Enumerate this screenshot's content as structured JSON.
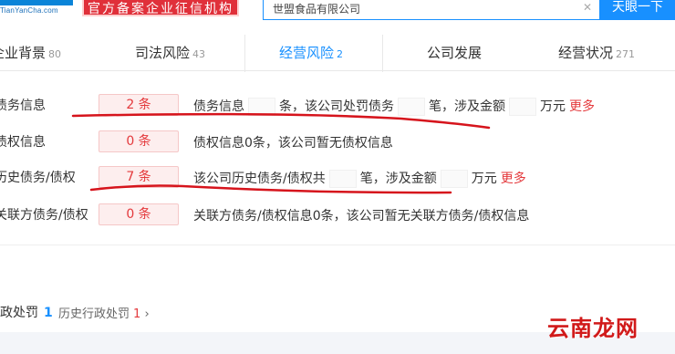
{
  "header": {
    "logo_sub": "TianYanCha.com",
    "cert_badge": "官方备案企业征信机构",
    "search_value": "世盟食品有限公司",
    "search_button": "天眼一下"
  },
  "tabs": [
    {
      "label": "企业背景",
      "count": "80",
      "active": false
    },
    {
      "label": "司法风险",
      "count": "43",
      "active": false
    },
    {
      "label": "经营风险",
      "count": "2",
      "active": true
    },
    {
      "label": "公司发展",
      "count": "",
      "active": false
    },
    {
      "label": "经营状况",
      "count": "271",
      "active": false
    }
  ],
  "rows": [
    {
      "label": "债务信息",
      "count": "2 条",
      "desc_a": "债务信息",
      "desc_b": "条，该公司处罚债务",
      "desc_c": "笔，涉及金额",
      "desc_d": "万元",
      "more": "更多"
    },
    {
      "label": "债权信息",
      "count": "0 条",
      "desc": "债权信息0条，该公司暂无债权信息"
    },
    {
      "label": "历史债务/债权",
      "count": "7 条",
      "desc_a": "该公司历史债务/债权共",
      "desc_b": "笔，涉及金额",
      "desc_c": "万元",
      "more": "更多"
    },
    {
      "label": "关联方债务/债权",
      "count": "0 条",
      "desc": "关联方债务/债权信息0条，该公司暂无关联方债务/债权信息"
    }
  ],
  "bottom": {
    "section_title": "行政处罚",
    "section_count": "1",
    "history_label": "历史行政处罚",
    "history_count": "1",
    "chevron": "›"
  },
  "watermark": "云南龙网",
  "colors": {
    "accent": "#1890ff",
    "alert": "#e4393c",
    "annotation": "#d6141c"
  }
}
